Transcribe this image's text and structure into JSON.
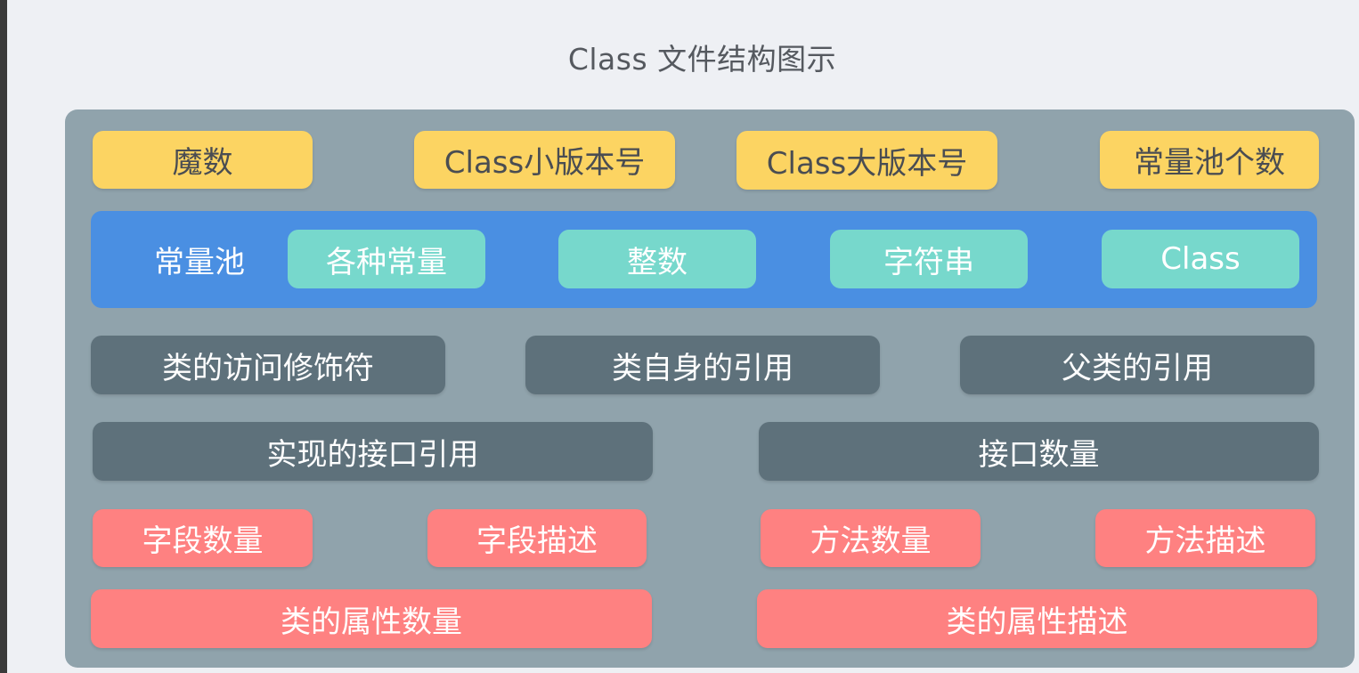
{
  "title": "Class 文件结构图示",
  "colors": {
    "background": "#eef0f4",
    "panel": "#90a3ac",
    "yellow": "#fcd462",
    "constant_pool": "#4a8fe2",
    "teal": "#77d8cc",
    "dark": "#5e717b",
    "red": "#fe8181"
  },
  "header_row": [
    "魔数",
    "Class小版本号",
    "Class大版本号",
    "常量池个数"
  ],
  "constant_pool": {
    "label": "常量池",
    "items": [
      "各种常量",
      "整数",
      "字符串",
      "Class"
    ]
  },
  "class_refs": [
    "类的访问修饰符",
    "类自身的引用",
    "父类的引用"
  ],
  "interfaces": [
    "实现的接口引用",
    "接口数量"
  ],
  "fields_methods": [
    "字段数量",
    "字段描述",
    "方法数量",
    "方法描述"
  ],
  "attributes": [
    "类的属性数量",
    "类的属性描述"
  ]
}
